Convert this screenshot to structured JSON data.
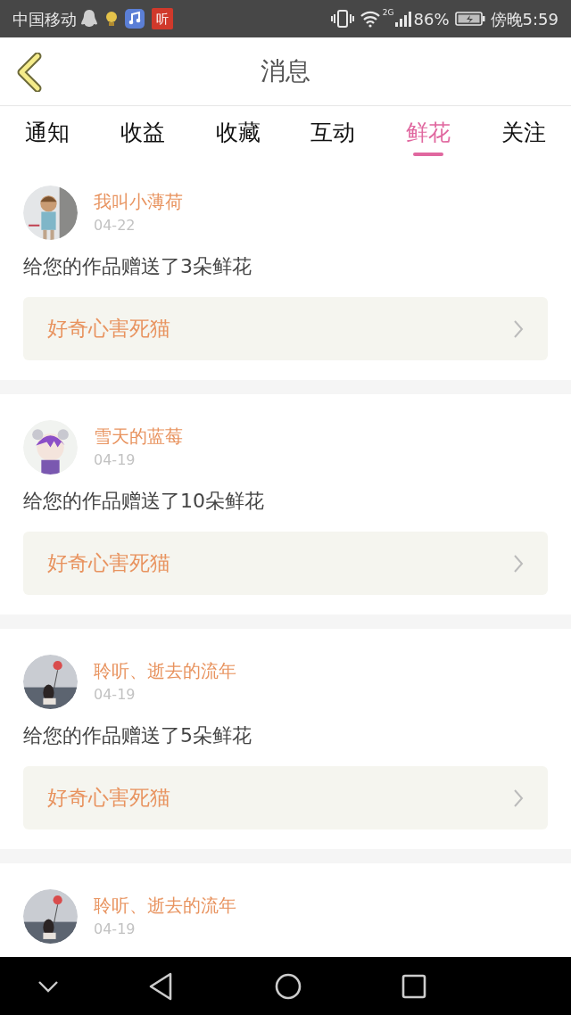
{
  "status_bar": {
    "carrier": "中国移动",
    "app_badge": "听",
    "network": "2G",
    "battery": "86%",
    "time": "傍晚5:59"
  },
  "header": {
    "title": "消息"
  },
  "tabs": [
    {
      "label": "通知",
      "selected": false
    },
    {
      "label": "收益",
      "selected": false
    },
    {
      "label": "收藏",
      "selected": false
    },
    {
      "label": "互动",
      "selected": false
    },
    {
      "label": "鲜花",
      "selected": true
    },
    {
      "label": "关注",
      "selected": false
    }
  ],
  "messages": [
    {
      "user": "我叫小薄荷",
      "date": "04-22",
      "text": "给您的作品赠送了3朵鲜花",
      "work": "好奇心害死猫"
    },
    {
      "user": "雪天的蓝莓",
      "date": "04-19",
      "text": "给您的作品赠送了10朵鲜花",
      "work": "好奇心害死猫"
    },
    {
      "user": "聆听、逝去的流年",
      "date": "04-19",
      "text": "给您的作品赠送了5朵鲜花",
      "work": "好奇心害死猫"
    },
    {
      "user": "聆听、逝去的流年",
      "date": "04-19"
    }
  ]
}
